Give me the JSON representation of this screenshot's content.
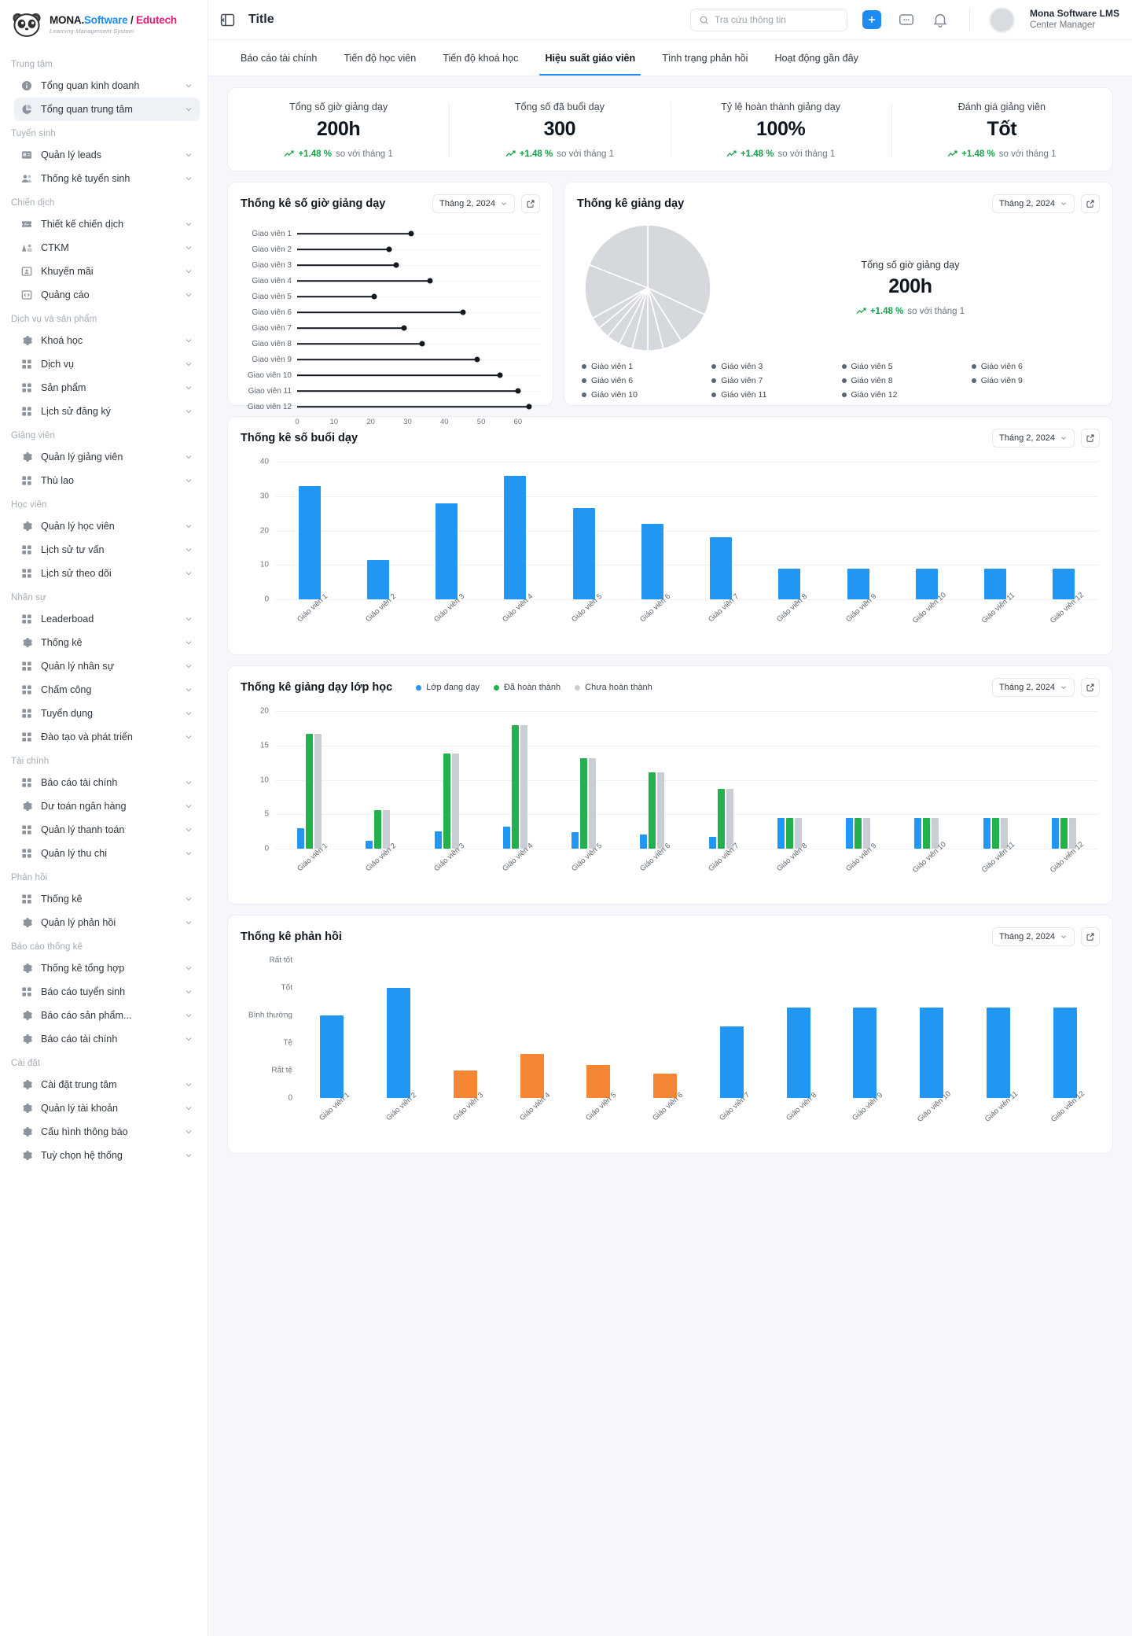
{
  "brand": {
    "name_mona": "MONA.",
    "name_software": "Software",
    "name_sep": " / ",
    "name_edutech": "Edutech",
    "tagline": "Learning Management System"
  },
  "topbar": {
    "page_title": "Title",
    "search_placeholder": "Tra cứu thông tin",
    "user_name": "Mona Software LMS",
    "user_role": "Center Manager"
  },
  "tabs": [
    {
      "label": "Báo cáo tài chính",
      "active": false
    },
    {
      "label": "Tiến độ học viên",
      "active": false
    },
    {
      "label": "Tiến độ khoá học",
      "active": false
    },
    {
      "label": "Hiệu suất giáo viên",
      "active": true
    },
    {
      "label": "Tình trạng phản hồi",
      "active": false
    },
    {
      "label": "Hoạt động gần đây",
      "active": false
    }
  ],
  "sidebar": {
    "groups": [
      {
        "title": "Trung tâm",
        "items": [
          {
            "label": "Tổng quan kinh doanh",
            "icon": "info-icon",
            "active": false
          },
          {
            "label": "Tổng quan trung tâm",
            "icon": "pie-icon",
            "active": true
          }
        ]
      },
      {
        "title": "Tuyển sinh",
        "items": [
          {
            "label": "Quản lý leads",
            "icon": "card-icon",
            "active": false
          },
          {
            "label": "Thống kê tuyển sinh",
            "icon": "users-icon",
            "active": false
          }
        ]
      },
      {
        "title": "Chiến dịch",
        "items": [
          {
            "label": "Thiết kế chiến dịch",
            "icon": "ticket-icon",
            "active": false
          },
          {
            "label": "CTKM",
            "icon": "megaphone-icon",
            "active": false
          },
          {
            "label": "Khuyến mãi",
            "icon": "person-box-icon",
            "active": false
          },
          {
            "label": "Quảng cáo",
            "icon": "code-icon",
            "active": false
          }
        ]
      },
      {
        "title": "Dịch vụ và sản phẩm",
        "items": [
          {
            "label": "Khoá học",
            "icon": "gear-icon",
            "active": false
          },
          {
            "label": "Dịch vụ",
            "icon": "grid-icon",
            "active": false
          },
          {
            "label": "Sản phẩm",
            "icon": "grid-icon",
            "active": false
          },
          {
            "label": "Lịch sử đăng ký",
            "icon": "grid-icon",
            "active": false
          }
        ]
      },
      {
        "title": "Giảng viên",
        "items": [
          {
            "label": "Quản lý giảng viên",
            "icon": "gear-icon",
            "active": false
          },
          {
            "label": "Thù lao",
            "icon": "grid-icon",
            "active": false
          }
        ]
      },
      {
        "title": "Học viên",
        "items": [
          {
            "label": "Quản lý học viên",
            "icon": "gear-icon",
            "active": false
          },
          {
            "label": "Lịch sử tư vấn",
            "icon": "grid-icon",
            "active": false
          },
          {
            "label": "Lịch sử theo dõi",
            "icon": "grid-icon",
            "active": false
          }
        ]
      },
      {
        "title": "Nhân sự",
        "items": [
          {
            "label": "Leaderboad",
            "icon": "grid-icon",
            "active": false
          },
          {
            "label": "Thống kê",
            "icon": "gear-icon",
            "active": false
          },
          {
            "label": "Quản lý nhân sự",
            "icon": "grid-icon",
            "active": false
          },
          {
            "label": "Chấm công",
            "icon": "grid-icon",
            "active": false
          },
          {
            "label": "Tuyển dụng",
            "icon": "grid-icon",
            "active": false
          },
          {
            "label": "Đào tạo và phát triển",
            "icon": "grid-icon",
            "active": false
          }
        ]
      },
      {
        "title": "Tài chính",
        "items": [
          {
            "label": "Báo cáo tài chính",
            "icon": "grid-icon",
            "active": false
          },
          {
            "label": "Dư toán ngân hàng",
            "icon": "gear-icon",
            "active": false
          },
          {
            "label": "Quản lý thanh toán",
            "icon": "grid-icon",
            "active": false
          },
          {
            "label": "Quản lý thu chi",
            "icon": "grid-icon",
            "active": false
          }
        ]
      },
      {
        "title": "Phản hồi",
        "items": [
          {
            "label": "Thống kê",
            "icon": "grid-icon",
            "active": false
          },
          {
            "label": "Quản lý phản hồi",
            "icon": "gear-icon",
            "active": false
          }
        ]
      },
      {
        "title": "Báo cáo thống kê",
        "items": [
          {
            "label": "Thống kê tổng hợp",
            "icon": "gear-icon",
            "active": false
          },
          {
            "label": "Báo cáo tuyển sinh",
            "icon": "grid-icon",
            "active": false
          },
          {
            "label": "Báo cáo sản phẩm...",
            "icon": "gear-icon",
            "active": false
          },
          {
            "label": "Báo cáo tài chính",
            "icon": "gear-icon",
            "active": false
          }
        ]
      },
      {
        "title": "Cài đặt",
        "items": [
          {
            "label": "Cài đặt trung tâm",
            "icon": "gear-icon",
            "active": false
          },
          {
            "label": "Quản lý tài khoản",
            "icon": "gear-icon",
            "active": false
          },
          {
            "label": "Cấu hình thông báo",
            "icon": "gear-icon",
            "active": false
          },
          {
            "label": "Tuỳ chọn hệ thống",
            "icon": "gear-icon",
            "active": false
          }
        ]
      }
    ]
  },
  "kpis": [
    {
      "label": "Tổng số giờ giảng dạy",
      "value": "200h",
      "delta": "+1.48 %",
      "delta_note": "so với tháng 1"
    },
    {
      "label": "Tổng số đã buổi dạy",
      "value": "300",
      "delta": "+1.48 %",
      "delta_note": "so với tháng 1"
    },
    {
      "label": "Tỷ lệ hoàn thành giảng dạy",
      "value": "100%",
      "delta": "+1.48 %",
      "delta_note": "so với tháng 1"
    },
    {
      "label": "Đánh giá giảng viên",
      "value": "Tốt",
      "delta": "+1.48 %",
      "delta_note": "so với tháng 1"
    }
  ],
  "month_label": "Tháng 2, 2024",
  "colors": {
    "accent": "#1d8bf1",
    "green": "#22b14c",
    "grey": "#c9ced4",
    "orange": "#f58634",
    "positive": "#15a34a",
    "dark": "#12181f"
  },
  "chart_data": [
    {
      "type": "bar",
      "orientation": "horizontal",
      "style": "lollipop",
      "title": "Thống kê số giờ giảng dạy",
      "month": "Tháng 2, 2024",
      "categories": [
        "Giao viên 1",
        "Giao viên 2",
        "Giao viên 3",
        "Giao viên 4",
        "Giao viên 5",
        "Giao viên 6",
        "Giao viên 7",
        "Giao viên 8",
        "Giao viên 9",
        "Giao viên 10",
        "Giao viên 11",
        "Giao viên 12"
      ],
      "values": [
        31,
        25,
        27,
        36,
        21,
        45,
        29,
        34,
        49,
        55,
        60,
        63
      ],
      "xlabel": "",
      "ylabel": "",
      "xticks": [
        0,
        10,
        20,
        30,
        40,
        50,
        60
      ],
      "xlim": [
        0,
        66
      ],
      "grid": true
    },
    {
      "type": "pie",
      "title": "Thống kê giảng dạy",
      "month": "Tháng 2, 2024",
      "side_label": "Tổng số giờ giảng dạy",
      "side_value": "200h",
      "side_delta": "+1.48 %",
      "side_delta_note": "so với tháng 1",
      "labels": [
        "Giáo viên 1",
        "Giáo viên 3",
        "Giáo viên 5",
        "Giáo viên 6",
        "Giáo viên 6",
        "Giáo viên 7",
        "Giáo viên 8",
        "Giáo viên 9",
        "Giáo viên 10",
        "Giáo viên 11",
        "Giáo viên 12"
      ],
      "slices": [
        32,
        9,
        5,
        4,
        4,
        3.5,
        3.5,
        3,
        3,
        14,
        19
      ],
      "legend_position": "bottom"
    },
    {
      "type": "bar",
      "title": "Thống kê số buổi dạy",
      "month": "Tháng 2, 2024",
      "categories": [
        "Giáo viên 1",
        "Giáo viên 2",
        "Giáo viên 3",
        "Giáo viên 4",
        "Giáo viên 5",
        "Giáo viên 6",
        "Giáo viên 7",
        "Giáo viên 8",
        "Giáo viên 9",
        "Giáo viên 10",
        "Giáo viên 11",
        "Giáo viên 12"
      ],
      "values": [
        33,
        11.5,
        28,
        36,
        26.5,
        22,
        18,
        9,
        9,
        9,
        9,
        9
      ],
      "yticks": [
        0,
        10,
        20,
        30,
        40
      ],
      "ylim": [
        0,
        40
      ],
      "series_color": "#2196f3",
      "grid": true
    },
    {
      "type": "bar",
      "title": "Thống kê giảng dạy lớp học",
      "month": "Tháng 2, 2024",
      "categories": [
        "Giáo viên 1",
        "Giáo viên 2",
        "Giáo viên 3",
        "Giáo viên 4",
        "Giáo viên 5",
        "Giáo viên 6",
        "Giáo viên 7",
        "Giáo viên 8",
        "Giáo viên 9",
        "Giáo viên 10",
        "Giáo viên 11",
        "Giáo viên 12"
      ],
      "series": [
        {
          "name": "Lớp đang dạy",
          "color": "#2196f3",
          "values": [
            3,
            1.2,
            2.5,
            3.2,
            2.4,
            2.1,
            1.7,
            4.5,
            4.5,
            4.5,
            4.5,
            4.5
          ]
        },
        {
          "name": "Đã hoàn thành",
          "color": "#22b14c",
          "values": [
            16.7,
            5.6,
            13.8,
            18,
            13.1,
            11.1,
            8.7,
            4.5,
            4.5,
            4.5,
            4.5,
            4.5
          ]
        },
        {
          "name": "Chưa hoàn thành",
          "color": "#c9ced4",
          "values": [
            16.7,
            5.6,
            13.8,
            18,
            13.1,
            11.1,
            8.7,
            4.5,
            4.5,
            4.5,
            4.5,
            4.5
          ]
        }
      ],
      "yticks": [
        0,
        5,
        10,
        15,
        20
      ],
      "ylim": [
        0,
        20
      ],
      "grid": true
    },
    {
      "type": "bar",
      "title": "Thống kê phản hồi",
      "month": "Tháng 2, 2024",
      "categories": [
        "Giáo viên 1",
        "Giáo viên 2",
        "Giáo viên 3",
        "Giáo viên 4",
        "Giáo viên 5",
        "Giáo viên 6",
        "Giáo viên 7",
        "Giáo viên 8",
        "Giáo viên 9",
        "Giáo viên 10",
        "Giáo viên 11",
        "Giáo viên 12"
      ],
      "yticks": [
        "0",
        "Rất tệ",
        "Tệ",
        "Bình thường",
        "Tốt",
        "Rất tốt"
      ],
      "values": [
        3,
        4,
        1,
        1.6,
        1.2,
        0.9,
        2.6,
        3.3,
        3.3,
        3.3,
        3.3,
        3.3
      ],
      "bar_colors": [
        "#2196f3",
        "#2196f3",
        "#f58634",
        "#f58634",
        "#f58634",
        "#f58634",
        "#2196f3",
        "#2196f3",
        "#2196f3",
        "#2196f3",
        "#2196f3",
        "#2196f3"
      ],
      "ylim": [
        0,
        5
      ],
      "grid": false
    }
  ]
}
